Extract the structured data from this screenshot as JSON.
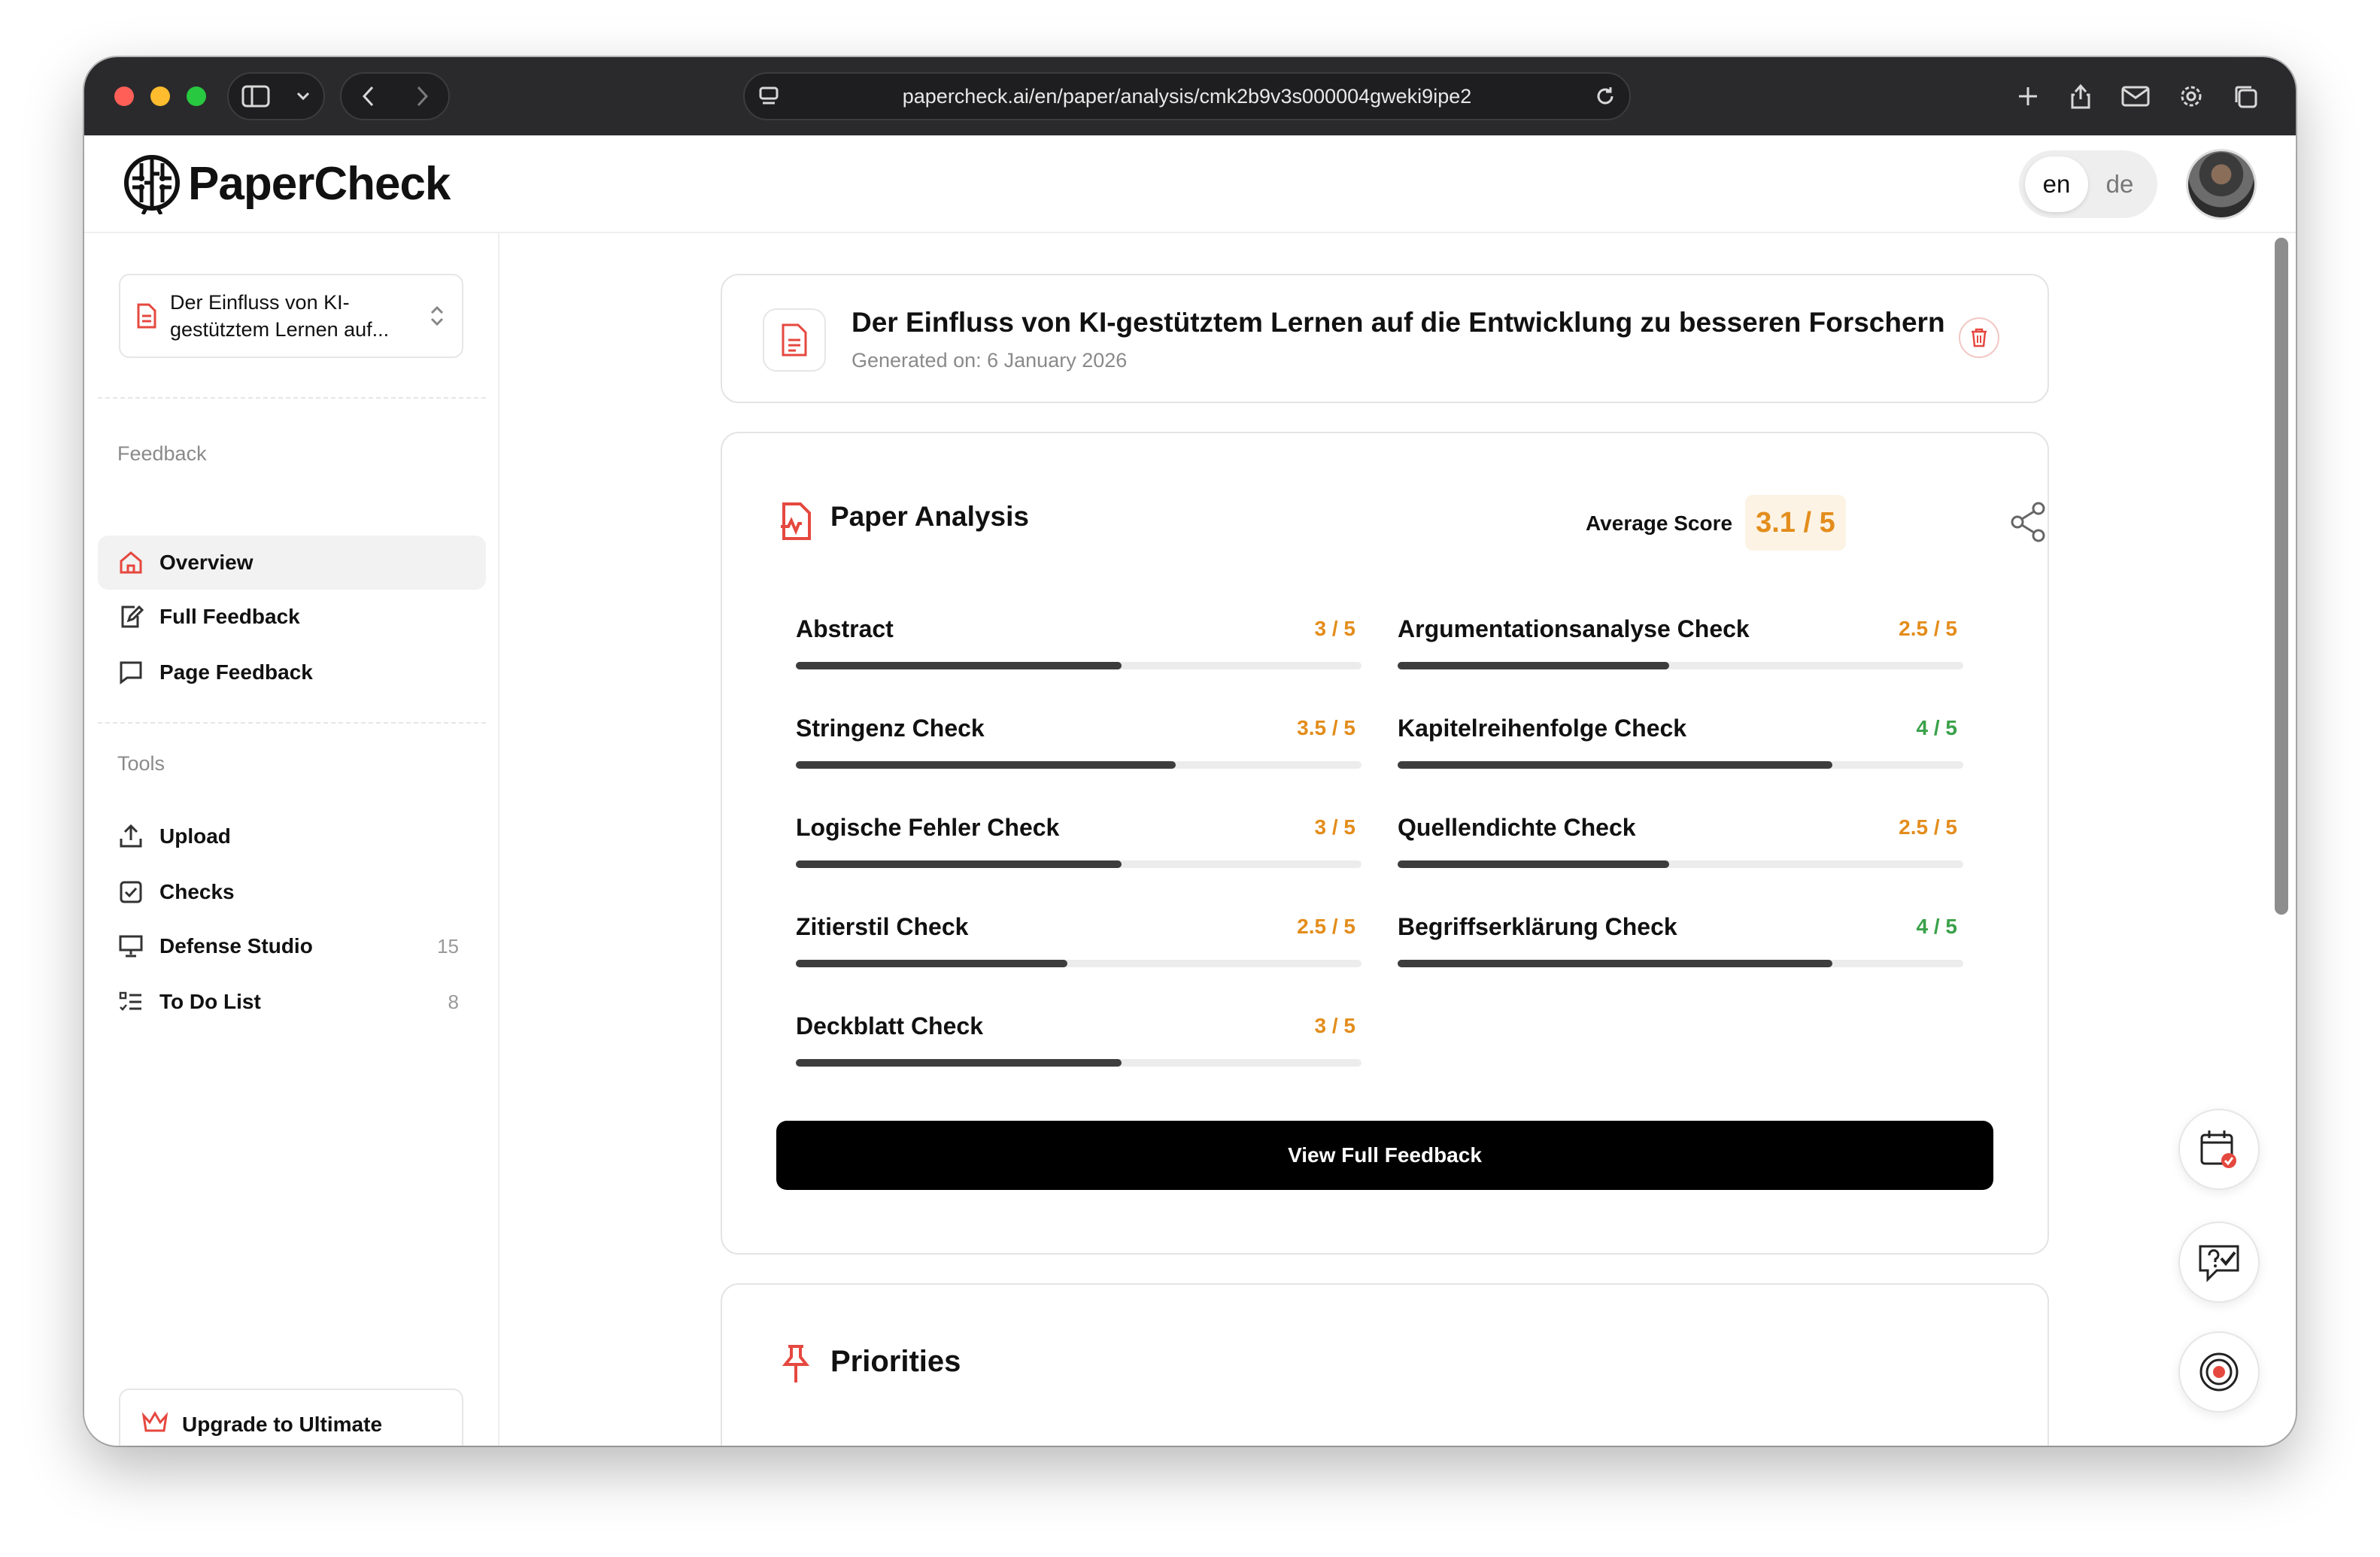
{
  "browser": {
    "url": "papercheck.ai/en/paper/analysis/cmk2b9v3s000004gweki9ipe2"
  },
  "header": {
    "logo_text": "PaperCheck",
    "lang_en": "en",
    "lang_de": "de"
  },
  "sidebar": {
    "paper_select": "Der Einfluss von KI-gestütztem Lernen auf...",
    "feedback_label": "Feedback",
    "feedback_items": [
      {
        "label": "Overview"
      },
      {
        "label": "Full Feedback"
      },
      {
        "label": "Page Feedback"
      }
    ],
    "tools_label": "Tools",
    "tools_items": [
      {
        "label": "Upload",
        "count": ""
      },
      {
        "label": "Checks",
        "count": ""
      },
      {
        "label": "Defense Studio",
        "count": "15"
      },
      {
        "label": "To Do List",
        "count": "8"
      }
    ],
    "upgrade": "Upgrade to Ultimate"
  },
  "paper": {
    "title": "Der Einfluss von KI-gestütztem Lernen auf die Entwicklung zu besseren Forschern",
    "generated": "Generated on: 6 January 2026"
  },
  "analysis": {
    "title": "Paper Analysis",
    "avg_label": "Average Score",
    "avg_score": "3.1 / 5",
    "metrics": [
      {
        "name": "Abstract",
        "score": "3 / 5",
        "value": 3,
        "color": "#e38d1c"
      },
      {
        "name": "Argumentationsanalyse Check",
        "score": "2.5 / 5",
        "value": 2.5,
        "color": "#e38d1c"
      },
      {
        "name": "Stringenz Check",
        "score": "3.5 / 5",
        "value": 3.5,
        "color": "#e38d1c"
      },
      {
        "name": "Kapitelreihenfolge Check",
        "score": "4 / 5",
        "value": 4,
        "color": "#3aa14a"
      },
      {
        "name": "Logische Fehler Check",
        "score": "3 / 5",
        "value": 3,
        "color": "#e38d1c"
      },
      {
        "name": "Quellendichte Check",
        "score": "2.5 / 5",
        "value": 2.5,
        "color": "#e38d1c"
      },
      {
        "name": "Zitierstil Check",
        "score": "2.5 / 5",
        "value": 2.5,
        "color": "#e38d1c"
      },
      {
        "name": "Begriffserklärung Check",
        "score": "4 / 5",
        "value": 4,
        "color": "#3aa14a"
      },
      {
        "name": "Deckblatt Check",
        "score": "3 / 5",
        "value": 3,
        "color": "#e38d1c"
      }
    ],
    "cta": "View Full Feedback"
  },
  "priorities": {
    "title": "Priorities"
  },
  "colors": {
    "accent_red": "#e5483f",
    "score_orange": "#e38d1c",
    "score_green": "#3aa14a"
  },
  "icons": {
    "fab_1": "calendar-icon",
    "fab_2": "question-check-icon",
    "fab_3": "target-icon"
  }
}
